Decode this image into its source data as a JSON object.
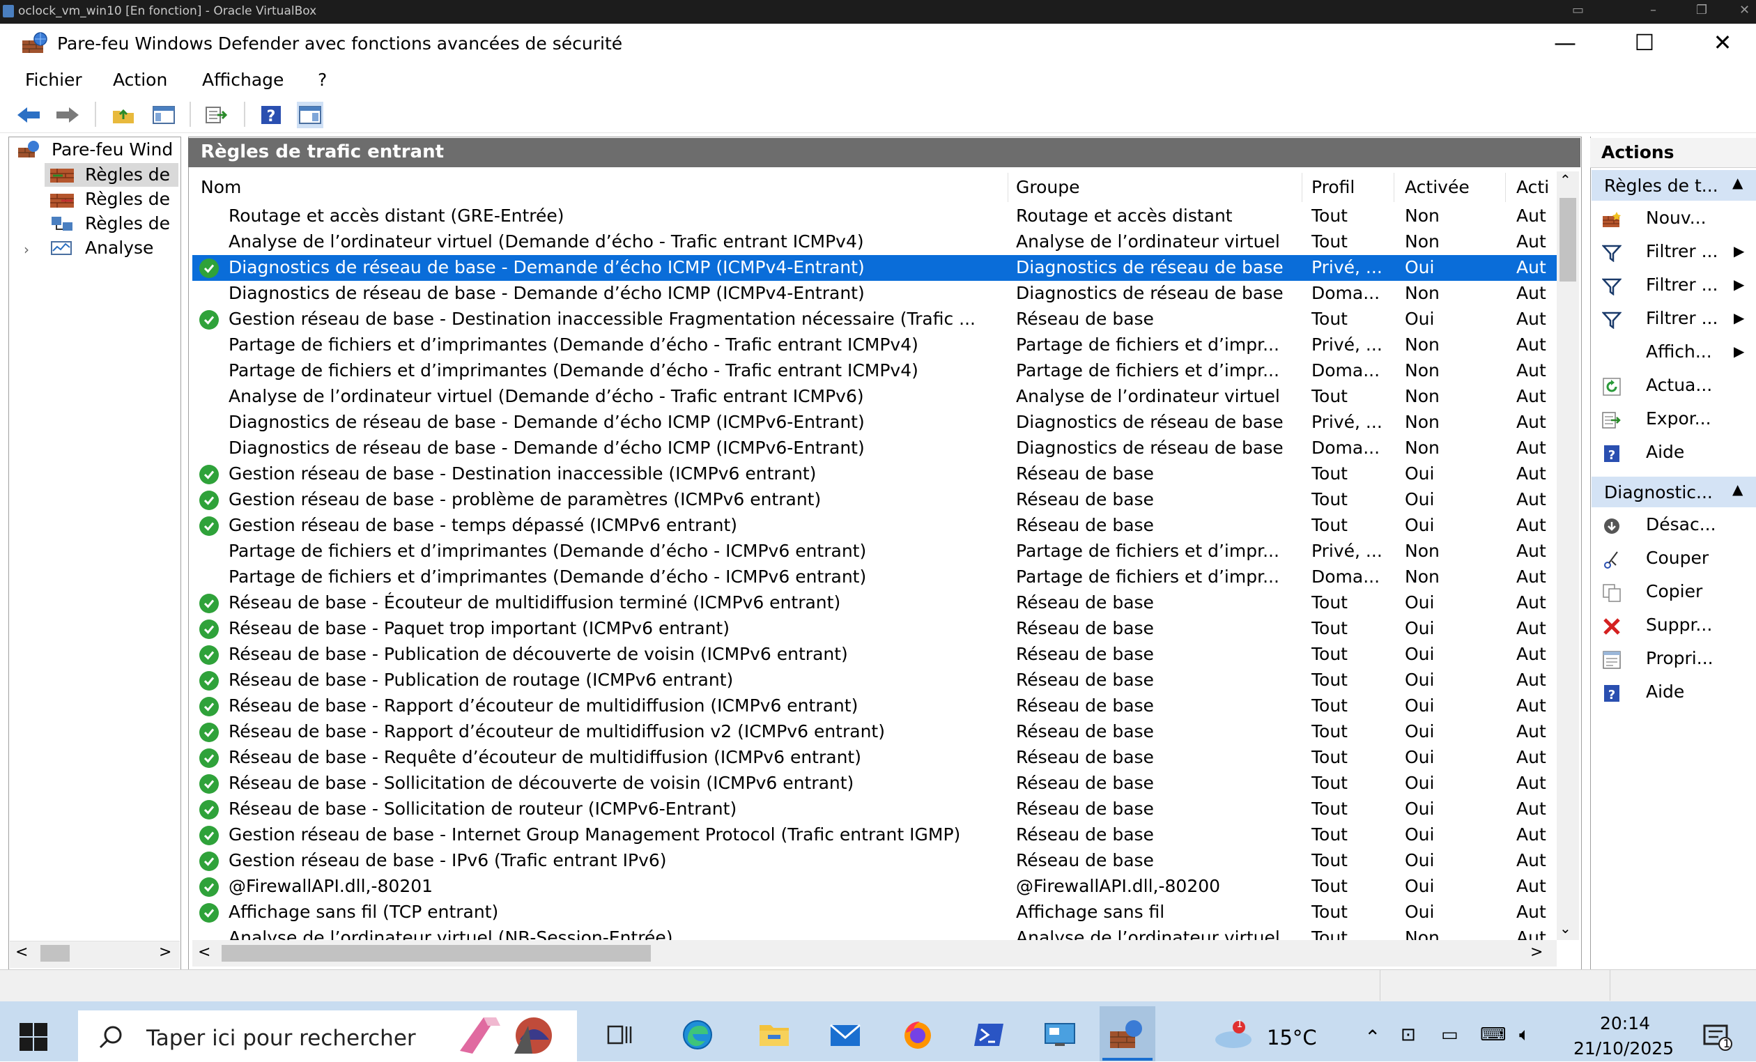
{
  "vbox": {
    "title": "oclock_vm_win10 [En fonction] - Oracle VirtualBox"
  },
  "window": {
    "title": "Pare-feu Windows Defender avec fonctions avancées de sécurité"
  },
  "menu": [
    "Fichier",
    "Action",
    "Affichage",
    "?"
  ],
  "tree": {
    "root": "Pare-feu Wind",
    "items": [
      "Règles de",
      "Règles de",
      "Règles de",
      "Analyse"
    ]
  },
  "center": {
    "title": "Règles de trafic entrant",
    "columns": [
      "Nom",
      "Groupe",
      "Profil",
      "Activée",
      "Acti"
    ],
    "rows": [
      {
        "enabled": false,
        "selected": false,
        "name": "Routage et accès distant (GRE-Entrée)",
        "group": "Routage et accès distant",
        "profile": "Tout",
        "active": "Non",
        "action": "Aut"
      },
      {
        "enabled": false,
        "selected": false,
        "name": "Analyse de l’ordinateur virtuel (Demande d’écho - Trafic entrant ICMPv4)",
        "group": "Analyse de l’ordinateur virtuel",
        "profile": "Tout",
        "active": "Non",
        "action": "Aut"
      },
      {
        "enabled": true,
        "selected": true,
        "name": "Diagnostics de réseau de base - Demande d’écho ICMP (ICMPv4-Entrant)",
        "group": "Diagnostics de réseau de base",
        "profile": "Privé, ...",
        "active": "Oui",
        "action": "Aut"
      },
      {
        "enabled": false,
        "selected": false,
        "name": "Diagnostics de réseau de base - Demande d’écho ICMP (ICMPv4-Entrant)",
        "group": "Diagnostics de réseau de base",
        "profile": "Doma...",
        "active": "Non",
        "action": "Aut"
      },
      {
        "enabled": true,
        "selected": false,
        "name": "Gestion réseau de base - Destination inaccessible Fragmentation nécessaire (Trafic ...",
        "group": "Réseau de base",
        "profile": "Tout",
        "active": "Oui",
        "action": "Aut"
      },
      {
        "enabled": false,
        "selected": false,
        "name": "Partage de fichiers et d’imprimantes (Demande d’écho - Trafic entrant ICMPv4)",
        "group": "Partage de fichiers et d’impr...",
        "profile": "Privé, ...",
        "active": "Non",
        "action": "Aut"
      },
      {
        "enabled": false,
        "selected": false,
        "name": "Partage de fichiers et d’imprimantes (Demande d’écho - Trafic entrant ICMPv4)",
        "group": "Partage de fichiers et d’impr...",
        "profile": "Doma...",
        "active": "Non",
        "action": "Aut"
      },
      {
        "enabled": false,
        "selected": false,
        "name": "Analyse de l’ordinateur virtuel (Demande d’écho - Trafic entrant ICMPv6)",
        "group": "Analyse de l’ordinateur virtuel",
        "profile": "Tout",
        "active": "Non",
        "action": "Aut"
      },
      {
        "enabled": false,
        "selected": false,
        "name": "Diagnostics de réseau de base - Demande d’écho ICMP (ICMPv6-Entrant)",
        "group": "Diagnostics de réseau de base",
        "profile": "Privé, ...",
        "active": "Non",
        "action": "Aut"
      },
      {
        "enabled": false,
        "selected": false,
        "name": "Diagnostics de réseau de base - Demande d’écho ICMP (ICMPv6-Entrant)",
        "group": "Diagnostics de réseau de base",
        "profile": "Doma...",
        "active": "Non",
        "action": "Aut"
      },
      {
        "enabled": true,
        "selected": false,
        "name": "Gestion réseau de base - Destination inaccessible (ICMPv6 entrant)",
        "group": "Réseau de base",
        "profile": "Tout",
        "active": "Oui",
        "action": "Aut"
      },
      {
        "enabled": true,
        "selected": false,
        "name": "Gestion réseau de base - problème de paramètres (ICMPv6 entrant)",
        "group": "Réseau de base",
        "profile": "Tout",
        "active": "Oui",
        "action": "Aut"
      },
      {
        "enabled": true,
        "selected": false,
        "name": "Gestion réseau de base - temps dépassé (ICMPv6 entrant)",
        "group": "Réseau de base",
        "profile": "Tout",
        "active": "Oui",
        "action": "Aut"
      },
      {
        "enabled": false,
        "selected": false,
        "name": "Partage de fichiers et d’imprimantes (Demande d’écho - ICMPv6 entrant)",
        "group": "Partage de fichiers et d’impr...",
        "profile": "Privé, ...",
        "active": "Non",
        "action": "Aut"
      },
      {
        "enabled": false,
        "selected": false,
        "name": "Partage de fichiers et d’imprimantes (Demande d’écho - ICMPv6 entrant)",
        "group": "Partage de fichiers et d’impr...",
        "profile": "Doma...",
        "active": "Non",
        "action": "Aut"
      },
      {
        "enabled": true,
        "selected": false,
        "name": "Réseau de base - Écouteur de multidiffusion terminé (ICMPv6 entrant)",
        "group": "Réseau de base",
        "profile": "Tout",
        "active": "Oui",
        "action": "Aut"
      },
      {
        "enabled": true,
        "selected": false,
        "name": "Réseau de base - Paquet trop important (ICMPv6 entrant)",
        "group": "Réseau de base",
        "profile": "Tout",
        "active": "Oui",
        "action": "Aut"
      },
      {
        "enabled": true,
        "selected": false,
        "name": "Réseau de base - Publication de découverte de voisin (ICMPv6 entrant)",
        "group": "Réseau de base",
        "profile": "Tout",
        "active": "Oui",
        "action": "Aut"
      },
      {
        "enabled": true,
        "selected": false,
        "name": "Réseau de base - Publication de routage (ICMPv6 entrant)",
        "group": "Réseau de base",
        "profile": "Tout",
        "active": "Oui",
        "action": "Aut"
      },
      {
        "enabled": true,
        "selected": false,
        "name": "Réseau de base - Rapport d’écouteur de multidiffusion (ICMPv6 entrant)",
        "group": "Réseau de base",
        "profile": "Tout",
        "active": "Oui",
        "action": "Aut"
      },
      {
        "enabled": true,
        "selected": false,
        "name": "Réseau de base - Rapport d’écouteur de multidiffusion v2 (ICMPv6 entrant)",
        "group": "Réseau de base",
        "profile": "Tout",
        "active": "Oui",
        "action": "Aut"
      },
      {
        "enabled": true,
        "selected": false,
        "name": "Réseau de base - Requête d’écouteur de multidiffusion (ICMPv6 entrant)",
        "group": "Réseau de base",
        "profile": "Tout",
        "active": "Oui",
        "action": "Aut"
      },
      {
        "enabled": true,
        "selected": false,
        "name": "Réseau de base - Sollicitation de découverte de voisin (ICMPv6 entrant)",
        "group": "Réseau de base",
        "profile": "Tout",
        "active": "Oui",
        "action": "Aut"
      },
      {
        "enabled": true,
        "selected": false,
        "name": "Réseau de base - Sollicitation de routeur (ICMPv6-Entrant)",
        "group": "Réseau de base",
        "profile": "Tout",
        "active": "Oui",
        "action": "Aut"
      },
      {
        "enabled": true,
        "selected": false,
        "name": "Gestion réseau de base - Internet Group Management Protocol (Trafic entrant IGMP)",
        "group": "Réseau de base",
        "profile": "Tout",
        "active": "Oui",
        "action": "Aut"
      },
      {
        "enabled": true,
        "selected": false,
        "name": "Gestion réseau de base - IPv6 (Trafic entrant IPv6)",
        "group": "Réseau de base",
        "profile": "Tout",
        "active": "Oui",
        "action": "Aut"
      },
      {
        "enabled": true,
        "selected": false,
        "name": "@FirewallAPI.dll,-80201",
        "group": "@FirewallAPI.dll,-80200",
        "profile": "Tout",
        "active": "Oui",
        "action": "Aut"
      },
      {
        "enabled": true,
        "selected": false,
        "name": "Affichage sans fil (TCP entrant)",
        "group": "Affichage sans fil",
        "profile": "Tout",
        "active": "Oui",
        "action": "Aut"
      },
      {
        "enabled": false,
        "selected": false,
        "name": "Analyse de l’ordinateur virtuel (NB-Session-Entrée)",
        "group": "Analyse de l’ordinateur virtuel",
        "profile": "Tout",
        "active": "Non",
        "action": "Aut"
      }
    ]
  },
  "actions": {
    "title": "Actions",
    "section1": {
      "label": "Règles de t...",
      "items": [
        {
          "label": "Nouv...",
          "icon": "new-rule-icon",
          "submenu": false
        },
        {
          "label": "Filtrer ...",
          "icon": "filter-icon",
          "submenu": true
        },
        {
          "label": "Filtrer ...",
          "icon": "filter-icon",
          "submenu": true
        },
        {
          "label": "Filtrer ...",
          "icon": "filter-icon",
          "submenu": true
        },
        {
          "label": "Affich...",
          "icon": "",
          "submenu": true
        },
        {
          "label": "Actua...",
          "icon": "refresh-icon",
          "submenu": false
        },
        {
          "label": "Expor...",
          "icon": "export-icon",
          "submenu": false
        },
        {
          "label": "Aide",
          "icon": "help-icon",
          "submenu": false
        }
      ]
    },
    "section2": {
      "label": "Diagnostic...",
      "items": [
        {
          "label": "Désac...",
          "icon": "disable-icon"
        },
        {
          "label": "Couper",
          "icon": "cut-icon"
        },
        {
          "label": "Copier",
          "icon": "copy-icon"
        },
        {
          "label": "Suppr...",
          "icon": "delete-icon"
        },
        {
          "label": "Propri...",
          "icon": "properties-icon"
        },
        {
          "label": "Aide",
          "icon": "help-icon"
        }
      ]
    }
  },
  "taskbar": {
    "search_placeholder": "Taper ici pour rechercher",
    "weather": "15°C",
    "weather_badge": "1",
    "time": "20:14",
    "date": "21/10/2025",
    "notification_count": "1"
  },
  "colors": {
    "selection": "#0a6dd9",
    "header_gray": "#6d6d6d",
    "enabled_green": "#2fa23a",
    "taskbar": "#c8dcf0"
  }
}
